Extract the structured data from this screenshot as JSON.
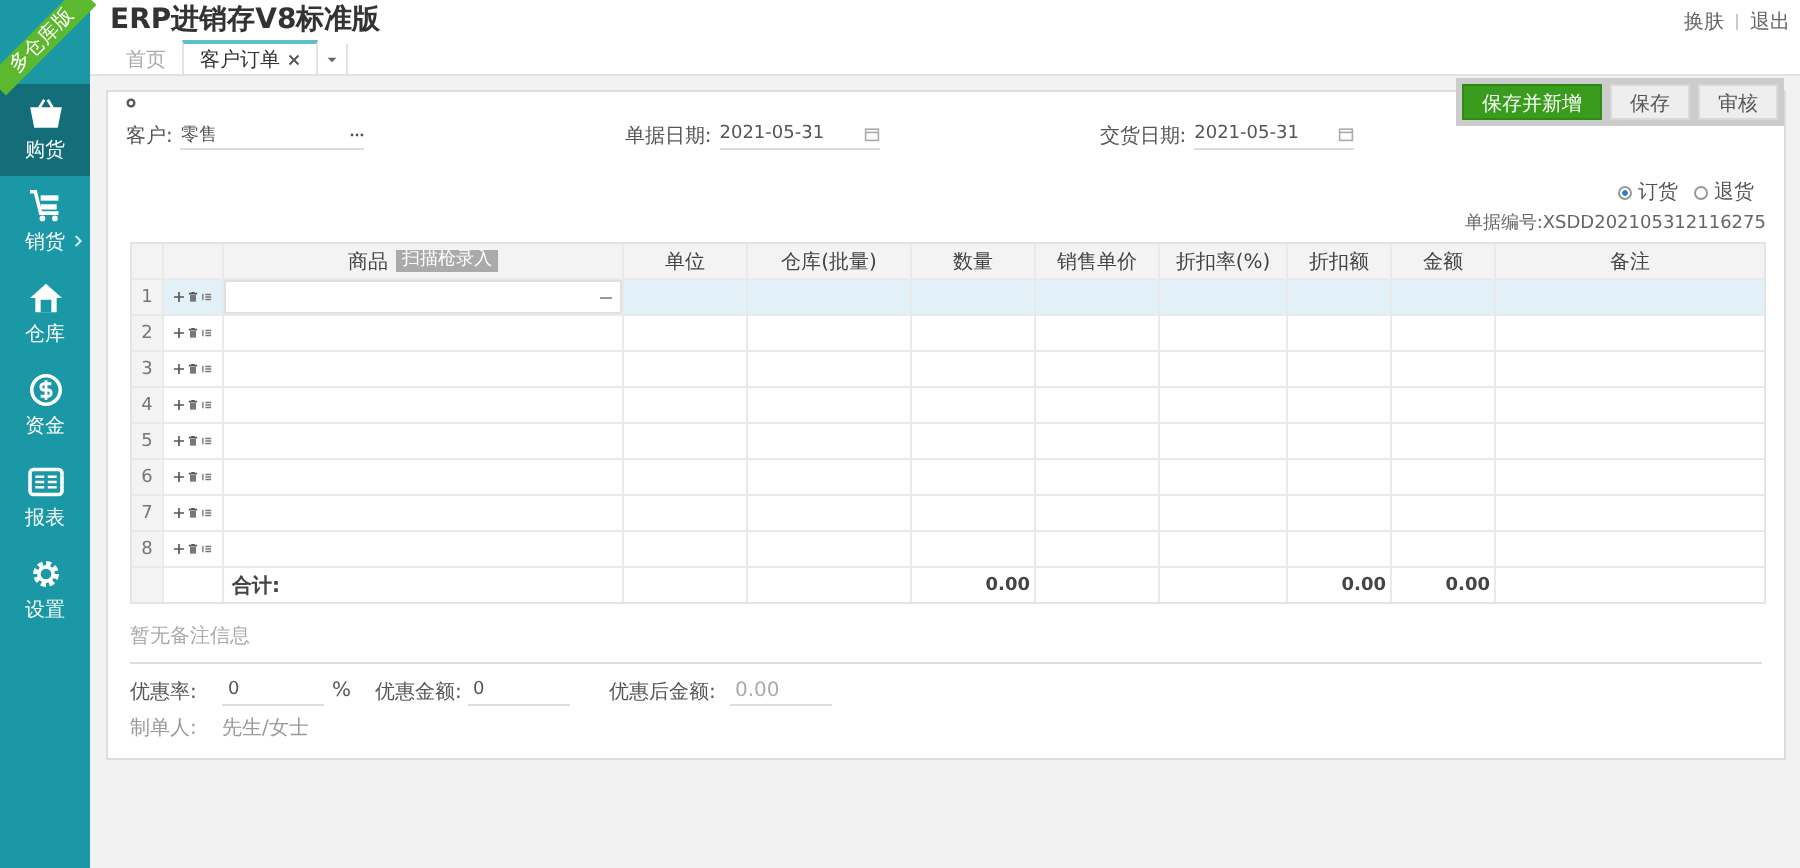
{
  "app": {
    "title": "ERP进销存V8标准版",
    "ribbon": "多仓库版",
    "header_links": [
      "换肤",
      "退出"
    ]
  },
  "sidebar": {
    "items": [
      {
        "label": "购货",
        "selected": true,
        "submenu": false
      },
      {
        "label": "销货",
        "selected": false,
        "submenu": true
      },
      {
        "label": "仓库",
        "selected": false,
        "submenu": false
      },
      {
        "label": "资金",
        "selected": false,
        "submenu": false
      },
      {
        "label": "报表",
        "selected": false,
        "submenu": false
      },
      {
        "label": "设置",
        "selected": false,
        "submenu": false
      }
    ]
  },
  "tabs": [
    {
      "label": "首页",
      "selected": false,
      "closable": false
    },
    {
      "label": "客户订单",
      "selected": true,
      "closable": true
    }
  ],
  "form": {
    "customer": {
      "label": "客户:",
      "value": "零售"
    },
    "order_date": {
      "label": "单据日期:",
      "value": "2021-05-31"
    },
    "delivery_date": {
      "label": "交货日期:",
      "value": "2021-05-31"
    },
    "buttons": [
      {
        "label": "保存并新增",
        "kind": "primary"
      },
      {
        "label": "保存",
        "kind": "default"
      },
      {
        "label": "审核",
        "kind": "default"
      }
    ],
    "order_types": [
      {
        "label": "订货",
        "selected": true
      },
      {
        "label": "退货",
        "selected": false
      }
    ],
    "order_number": {
      "label": "单据编号:",
      "value": "XSDD202105312116275"
    }
  },
  "table": {
    "columns": [
      {
        "label": "商品",
        "badge": "扫描枪录入"
      },
      {
        "label": "单位"
      },
      {
        "label": "仓库(批量)"
      },
      {
        "label": "数量",
        "total": "0.00"
      },
      {
        "label": "销售单价"
      },
      {
        "label": "折扣率(%)"
      },
      {
        "label": "折扣额",
        "total": "0.00"
      },
      {
        "label": "金额",
        "total": "0.00"
      },
      {
        "label": "备注"
      }
    ],
    "rows": [
      {
        "number": "1",
        "selected": true
      },
      {
        "number": "2",
        "selected": false
      },
      {
        "number": "3",
        "selected": false
      },
      {
        "number": "4",
        "selected": false
      },
      {
        "number": "5",
        "selected": false
      },
      {
        "number": "6",
        "selected": false
      },
      {
        "number": "7",
        "selected": false
      },
      {
        "number": "8",
        "selected": false
      }
    ],
    "total_label": "合计:"
  },
  "remark": {
    "placeholder": "暂无备注信息"
  },
  "footer": {
    "discount_rate": {
      "label": "优惠率:",
      "value": "0",
      "unit": "%"
    },
    "discount_amount": {
      "label": "优惠金额:",
      "value": "0"
    },
    "after_discount": {
      "label": "优惠后金额:",
      "value": "0.00",
      "disabled": true
    },
    "creator": {
      "label": "制单人:",
      "value": "先生/女士"
    }
  }
}
